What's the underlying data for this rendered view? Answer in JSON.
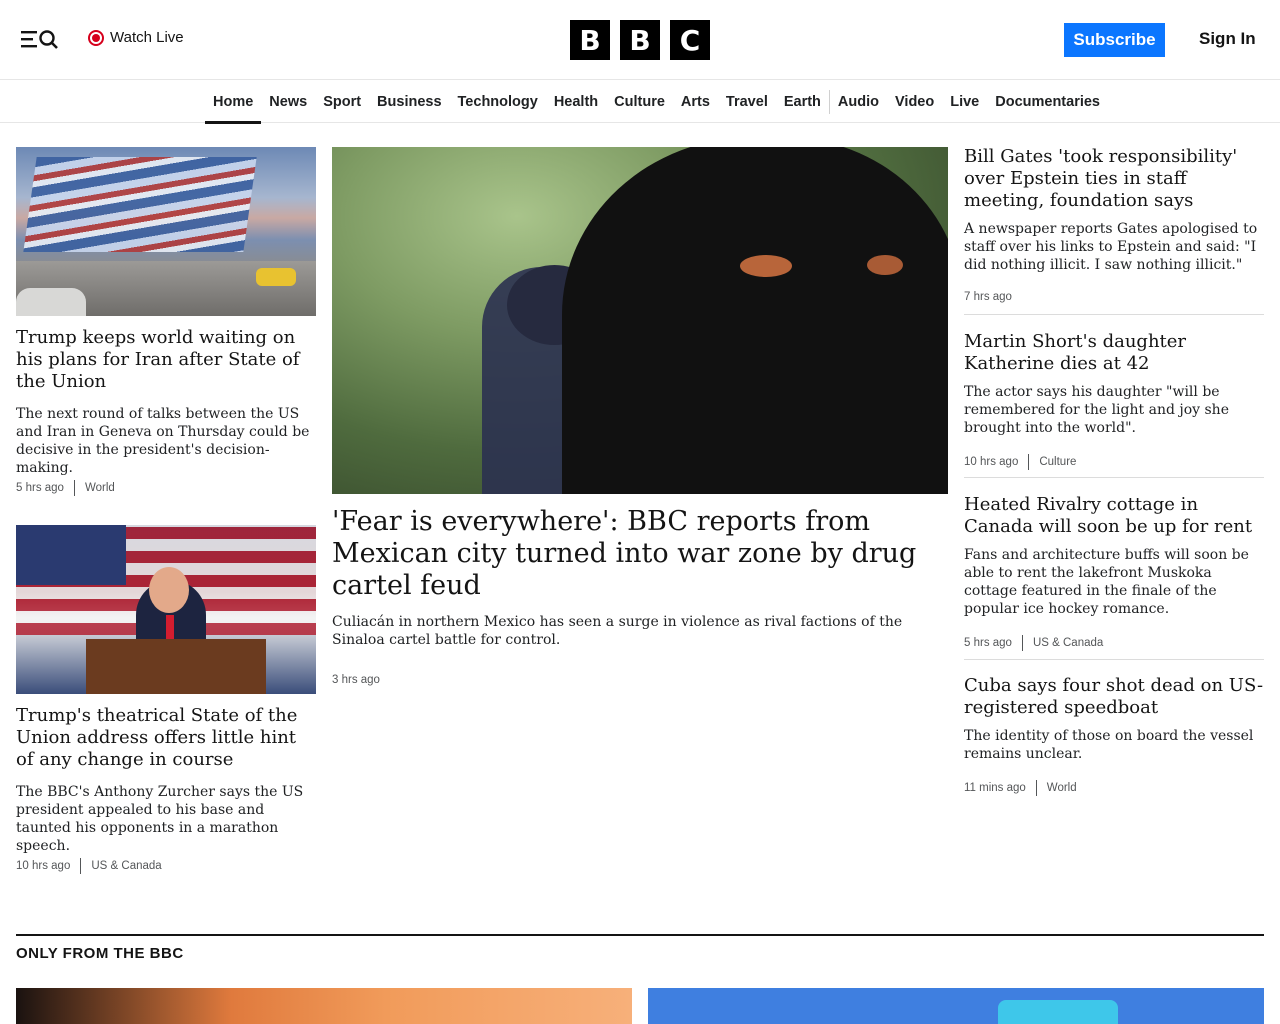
{
  "header": {
    "watch_live": "Watch Live",
    "logo_letters": [
      "B",
      "B",
      "C"
    ],
    "subscribe": "Subscribe",
    "sign_in": "Sign In",
    "accent_color": "#0b76ff",
    "live_color": "#d6001c"
  },
  "nav": {
    "items": [
      "Home",
      "News",
      "Sport",
      "Business",
      "Technology",
      "Health",
      "Culture",
      "Arts",
      "Travel",
      "Earth",
      "Audio",
      "Video",
      "Live",
      "Documentaries"
    ],
    "active": "Home"
  },
  "left_column": [
    {
      "headline": "Trump keeps world waiting on his plans for Iran after State of the Union",
      "summary": "The next round of talks between the US and Iran in Geneva on Thursday could be decisive in the president's decision-making.",
      "time": "5 hrs ago",
      "category": "World"
    },
    {
      "headline": "Trump's theatrical State of the Union address offers little hint of any change in course",
      "summary": "The BBC's Anthony Zurcher says the US president appealed to his base and taunted his opponents in a marathon speech.",
      "time": "10 hrs ago",
      "category": "US & Canada"
    }
  ],
  "main_story": {
    "headline": "'Fear is everywhere': BBC reports from Mexican city turned into war zone by drug cartel feud",
    "summary": "Culiacán in northern Mexico has seen a surge in violence as rival factions of the Sinaloa cartel battle for control.",
    "time": "3 hrs ago"
  },
  "right_column": [
    {
      "headline": "Bill Gates 'took responsibility' over Epstein ties in staff meeting, foundation says",
      "summary": "A newspaper reports Gates apologised to staff over his links to Epstein and said: \"I did nothing illicit. I saw nothing illicit.\"",
      "time": "7 hrs ago",
      "category": ""
    },
    {
      "headline": "Martin Short's daughter Katherine dies at 42",
      "summary": "The actor says his daughter \"will be remembered for the light and joy she brought into the world\".",
      "time": "10 hrs ago",
      "category": "Culture"
    },
    {
      "headline": "Heated Rivalry cottage in Canada will soon be up for rent",
      "summary": "Fans and architecture buffs will soon be able to rent the lakefront Muskoka cottage featured in the finale of the popular ice hockey romance.",
      "time": "5 hrs ago",
      "category": "US & Canada"
    },
    {
      "headline": "Cuba says four shot dead on US-registered speedboat",
      "summary": "The identity of those on board the vessel remains unclear.",
      "time": "11 mins ago",
      "category": "World"
    }
  ],
  "section": {
    "title": "ONLY FROM THE BBC"
  }
}
